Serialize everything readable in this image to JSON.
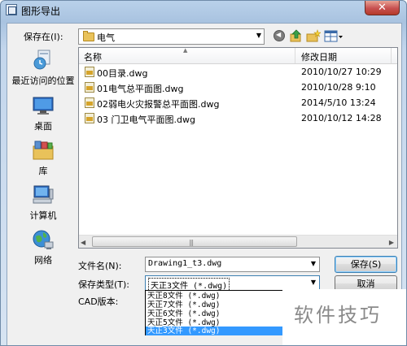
{
  "window": {
    "title": "图形导出",
    "close_glyph": "✕"
  },
  "lookin": {
    "label": "保存在(I):",
    "value": "电气"
  },
  "places": [
    {
      "label": "最近访问的位置",
      "icon": "recent-places-icon"
    },
    {
      "label": "桌面",
      "icon": "desktop-icon"
    },
    {
      "label": "库",
      "icon": "libraries-icon"
    },
    {
      "label": "计算机",
      "icon": "computer-icon"
    },
    {
      "label": "网络",
      "icon": "network-icon"
    }
  ],
  "file_list": {
    "columns": {
      "name": "名称",
      "date": "修改日期"
    },
    "rows": [
      {
        "name": "00目录.dwg",
        "date": "2010/10/27 10:29"
      },
      {
        "name": "01电气总平面图.dwg",
        "date": "2010/10/28 9:10"
      },
      {
        "name": "02弱电火灾报警总平面图.dwg",
        "date": "2014/5/10 13:24"
      },
      {
        "name": "03 门卫电气平面图.dwg",
        "date": "2010/10/12 14:28"
      }
    ]
  },
  "filename": {
    "label": "文件名(N):",
    "value": "Drawing1_t3.dwg"
  },
  "filetype": {
    "label": "保存类型(T):",
    "value": "天正3文件 (*.dwg)",
    "options": [
      "天正8文件 (*.dwg)",
      "天正7文件 (*.dwg)",
      "天正6文件 (*.dwg)",
      "天正5文件 (*.dwg)",
      "天正3文件 (*.dwg)"
    ],
    "selected_index": 4
  },
  "cad_version": {
    "label": "CAD版本:"
  },
  "buttons": {
    "save": "保存(S)",
    "cancel": "取消"
  },
  "watermark": "软件技巧",
  "colors": {
    "selection": "#3399ff",
    "close_button": "#c75050",
    "folder": "#e9c25a"
  }
}
